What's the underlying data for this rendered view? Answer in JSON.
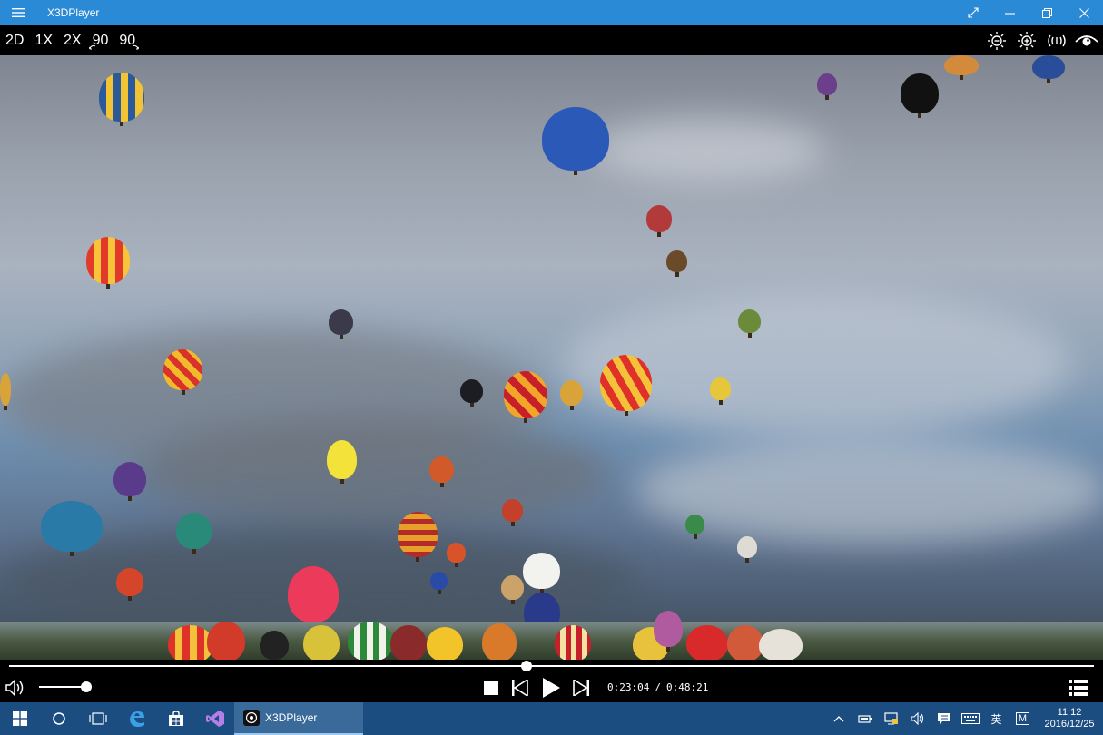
{
  "window": {
    "title": "X3DPlayer",
    "controls": [
      "fullscreen-icon",
      "minimize-icon",
      "restore-icon",
      "close-icon"
    ]
  },
  "toolbar": {
    "mode_2d": "2D",
    "zoom_1x": "1X",
    "zoom_2x": "2X",
    "rotate_left": "90",
    "rotate_right": "90",
    "right_icons": [
      "brightness-down-icon",
      "brightness-up-icon",
      "cast-icon",
      "eye-icon"
    ]
  },
  "player": {
    "current_time": "0:23:04",
    "separator": "/",
    "total_time": "0:48:21",
    "progress": 0.477,
    "volume": 0.9
  },
  "taskbar": {
    "running_app": "X3DPlayer",
    "ime_label": "英",
    "input_mode": "M",
    "time": "11:12",
    "date": "2016/12/25"
  },
  "colors": {
    "titlebar": "#2b8ad6",
    "taskbar": "#1c4d80",
    "controls_bg": "#000000"
  }
}
